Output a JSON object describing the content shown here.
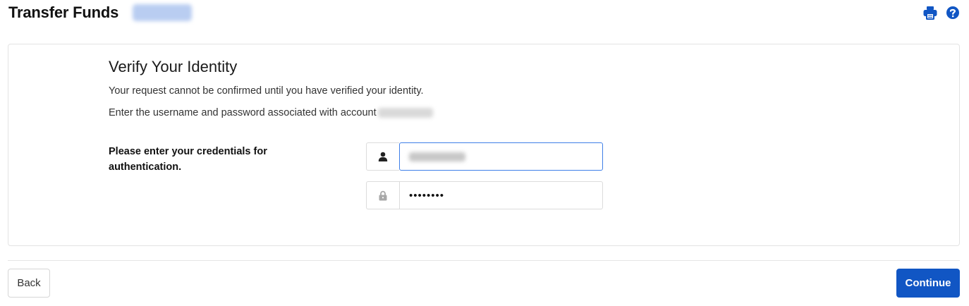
{
  "header": {
    "title": "Transfer Funds",
    "icons": [
      "print-icon",
      "help-icon"
    ],
    "accent_color": "#1156c4"
  },
  "verify": {
    "title": "Verify Your Identity",
    "message": "Your request cannot be confirmed until you have verified your identity.",
    "account_prompt": "Enter the username and password associated with account",
    "credentials_label": "Please enter your credentials for authentication.",
    "username_icon": "user-icon",
    "password_icon": "lock-icon",
    "password_value": "••••••••"
  },
  "footer": {
    "back_label": "Back",
    "continue_label": "Continue",
    "continue_color": "#1156c4"
  }
}
